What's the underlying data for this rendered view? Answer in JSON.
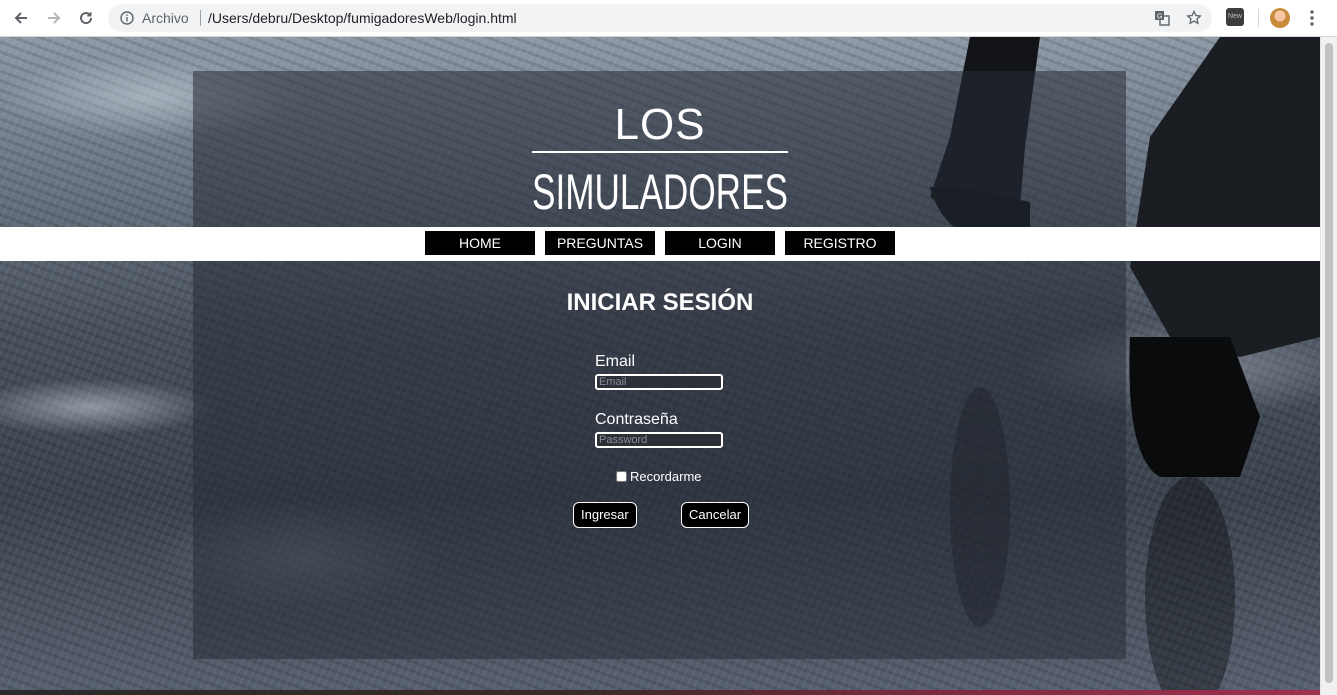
{
  "browser": {
    "scheme_label": "Archivo",
    "url": "/Users/debru/Desktop/fumigadoresWeb/login.html",
    "extension_badge": "New"
  },
  "logo": {
    "line1": "LOS",
    "line2": "SIMULADORES"
  },
  "nav": {
    "items": [
      {
        "label": "HOME"
      },
      {
        "label": "PREGUNTAS"
      },
      {
        "label": "LOGIN"
      },
      {
        "label": "REGISTRO"
      }
    ]
  },
  "login": {
    "title": "INICIAR SESIÓN",
    "email_label": "Email",
    "email_placeholder": "Email",
    "password_label": "Contraseña",
    "password_placeholder": "Password",
    "remember_label": "Recordarme",
    "submit_label": "Ingresar",
    "cancel_label": "Cancelar"
  },
  "colors": {
    "panel": "#282e38",
    "nav_button": "#000000",
    "text": "#ffffff"
  }
}
